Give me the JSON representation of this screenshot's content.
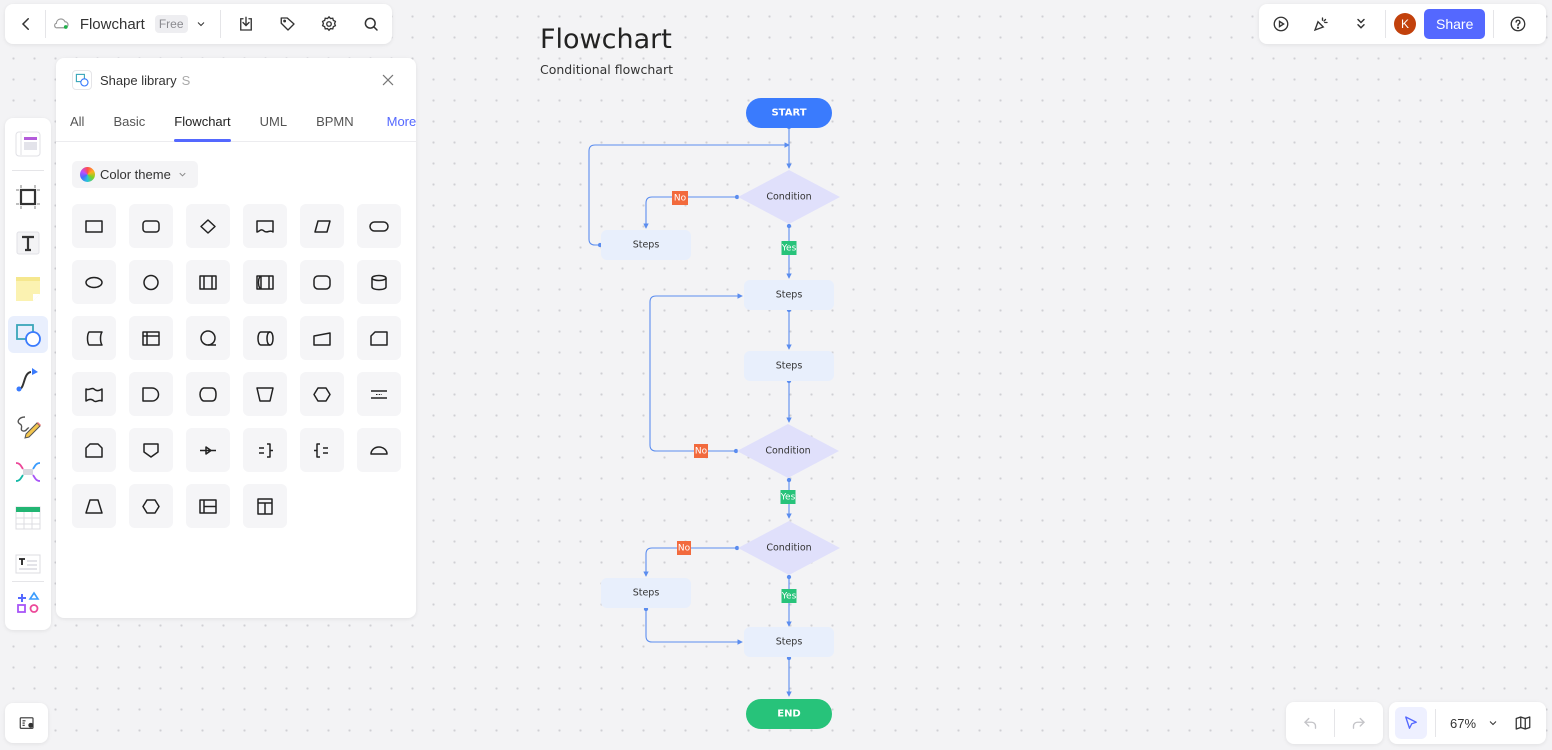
{
  "top_toolbar": {
    "back_icon": "chevron-left-icon",
    "cloud_icon": "cloud-synced-icon",
    "document_title": "Flowchart",
    "plan_badge": "Free",
    "dropdown_icon": "chevron-down-icon",
    "actions": [
      {
        "name": "export",
        "icon": "download-icon"
      },
      {
        "name": "tag",
        "icon": "tag-icon"
      },
      {
        "name": "settings",
        "icon": "gear-icon"
      },
      {
        "name": "search",
        "icon": "search-icon"
      }
    ]
  },
  "top_right": {
    "present_icon": "play-icon",
    "celebrate_icon": "party-popper-icon",
    "collapse_icon": "double-chevron-down-icon",
    "avatar_initial": "K",
    "share_label": "Share",
    "help_icon": "help-icon",
    "colors": {
      "avatar": "#c2410c",
      "share": "#5468ff"
    }
  },
  "left_rail": {
    "items": [
      {
        "name": "templates",
        "icon": "template-icon"
      },
      {
        "name": "frame",
        "icon": "frame-icon"
      },
      {
        "name": "text",
        "icon": "text-icon"
      },
      {
        "name": "sticky-note",
        "icon": "sticky-note-icon"
      },
      {
        "name": "shapes",
        "icon": "shapes-icon",
        "active": true
      },
      {
        "name": "connector",
        "icon": "connector-icon"
      },
      {
        "name": "pen",
        "icon": "pen-icon"
      },
      {
        "name": "mind-map",
        "icon": "mind-map-icon"
      },
      {
        "name": "table",
        "icon": "table-icon"
      },
      {
        "name": "text-block",
        "icon": "text-block-icon"
      },
      {
        "name": "more-tools",
        "icon": "more-shapes-icon"
      }
    ]
  },
  "shape_library": {
    "title": "Shape library",
    "shortcut": "S",
    "tabs": [
      {
        "label": "All"
      },
      {
        "label": "Basic"
      },
      {
        "label": "Flowchart",
        "active": true
      },
      {
        "label": "UML"
      },
      {
        "label": "BPMN"
      }
    ],
    "more_label": "More",
    "color_theme_label": "Color theme",
    "shapes": [
      "process",
      "rounded-process",
      "decision",
      "document",
      "data",
      "terminator",
      "ellipse",
      "connector-circle",
      "predefined-process",
      "stored-data-process",
      "alternate-process",
      "database",
      "stored-data",
      "internal-storage",
      "sequential-access",
      "direct-access",
      "manual-input",
      "card",
      "punched-tape",
      "delay",
      "display",
      "manual-operation",
      "preparation",
      "parallel-mode",
      "loop-limit",
      "off-page-connector",
      "transfer",
      "annotation-right",
      "annotation-left",
      "semicircle",
      "trapezoid",
      "hexagon",
      "horizontal-container",
      "vertical-container"
    ]
  },
  "canvas": {
    "title": "Flowchart",
    "subtitle": "Conditional flowchart",
    "nodes": {
      "start": "START",
      "end": "END",
      "condition": "Condition",
      "steps": "Steps",
      "yes": "Yes",
      "no": "No"
    },
    "colors": {
      "start": "#3a7bfd",
      "end": "#27c37a",
      "decision": "#e0e0fb",
      "step": "#e8effc",
      "edge": "#5b8def",
      "yes": "#27c37a",
      "no": "#f26a3d"
    }
  },
  "bottom": {
    "page_settings_icon": "page-settings-icon",
    "undo_icon": "undo-icon",
    "redo_icon": "redo-icon",
    "pointer_icon": "cursor-icon",
    "zoom_level": "67%",
    "zoom_dropdown_icon": "chevron-down-icon",
    "minimap_icon": "map-icon"
  }
}
